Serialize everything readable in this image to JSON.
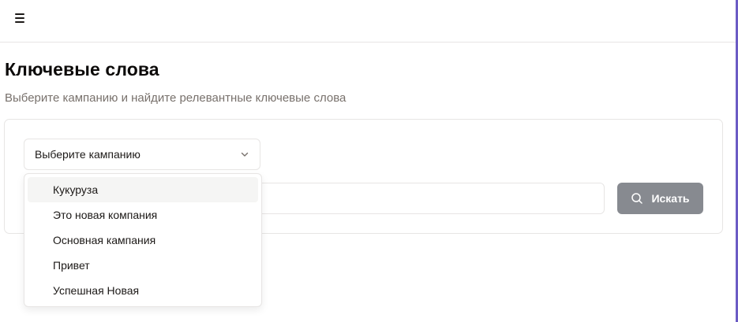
{
  "header": {
    "menu_icon": "hamburger-menu-icon"
  },
  "page": {
    "title": "Ключевые слова",
    "subtitle": "Выберите кампанию и найдите релевантные ключевые слова"
  },
  "form": {
    "campaign_select": {
      "value": "Выберите кампанию",
      "icon": "chevron-down-icon",
      "options": [
        "Кукуруза",
        "Это новая компания",
        "Основная кампания",
        "Привет",
        "Успешная Новая"
      ],
      "highlighted_index": 0
    },
    "keyword_input": {
      "value": "",
      "placeholder": ""
    },
    "search_button": {
      "label": "Искать",
      "icon": "search-icon"
    }
  },
  "colors": {
    "accent_rail": "#6b5bc4",
    "button_bg": "#878a90",
    "border": "#e7e5e4",
    "muted_text": "#78716c"
  }
}
